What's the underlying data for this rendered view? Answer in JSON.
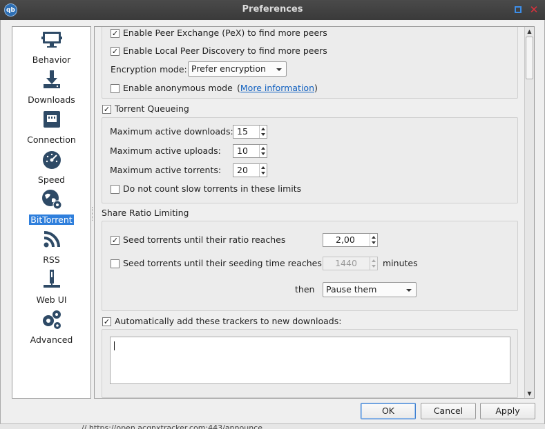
{
  "window": {
    "title": "Preferences",
    "app_icon": "qb"
  },
  "sidebar": {
    "items": [
      {
        "label": "Behavior",
        "icon": "monitor-icon"
      },
      {
        "label": "Downloads",
        "icon": "download-icon"
      },
      {
        "label": "Connection",
        "icon": "network-icon"
      },
      {
        "label": "Speed",
        "icon": "gauge-icon"
      },
      {
        "label": "BitTorrent",
        "icon": "globe-gear-icon",
        "selected": true
      },
      {
        "label": "RSS",
        "icon": "rss-icon"
      },
      {
        "label": "Web UI",
        "icon": "webui-icon"
      },
      {
        "label": "Advanced",
        "icon": "gears-icon"
      }
    ]
  },
  "privacy": {
    "pex_label": "Enable Peer Exchange (PeX) to find more peers",
    "pex_checked": true,
    "lpd_label": "Enable Local Peer Discovery to find more peers",
    "lpd_checked": true,
    "encryption_label": "Encryption mode:",
    "encryption_value": "Prefer encryption",
    "anonymous_label": "Enable anonymous mode",
    "anonymous_checked": false,
    "paren_open": "(",
    "more_info_link": "More information",
    "paren_close": ")"
  },
  "queueing": {
    "title": "Torrent Queueing",
    "checked": true,
    "max_downloads_label": "Maximum active downloads:",
    "max_downloads_value": "15",
    "max_uploads_label": "Maximum active uploads:",
    "max_uploads_value": "10",
    "max_torrents_label": "Maximum active torrents:",
    "max_torrents_value": "20",
    "slow_label": "Do not count slow torrents in these limits",
    "slow_checked": false
  },
  "share_ratio": {
    "title": "Share Ratio Limiting",
    "ratio_label": "Seed torrents until their ratio reaches",
    "ratio_checked": true,
    "ratio_value": "2,00",
    "seeding_time_label": "Seed torrents until their seeding time reaches",
    "seeding_time_checked": false,
    "seeding_time_value": "1440",
    "minutes_label": "minutes",
    "then_label": "then",
    "action_value": "Pause them"
  },
  "trackers": {
    "label": "Automatically add these trackers to new downloads:",
    "checked": true,
    "text": ""
  },
  "buttons": {
    "ok": "OK",
    "cancel": "Cancel",
    "apply": "Apply"
  },
  "background_text": "// https://open.acgnxtracker.com:443/announce"
}
